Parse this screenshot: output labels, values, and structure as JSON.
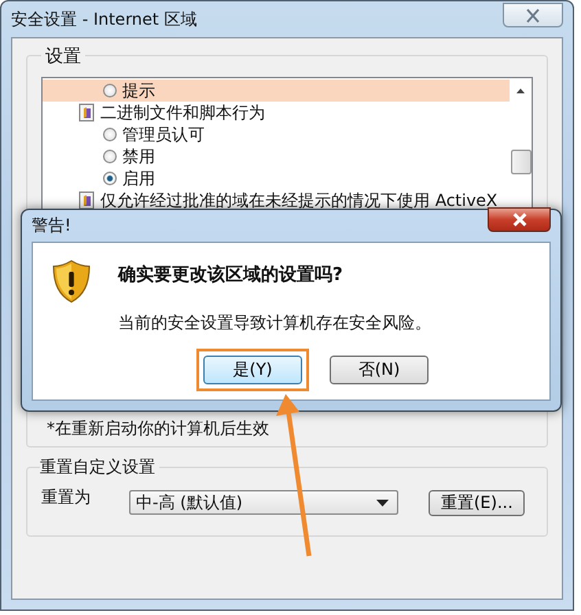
{
  "window": {
    "title": "安全设置 - Internet 区域"
  },
  "settings": {
    "label": "设置",
    "items": [
      {
        "kind": "radio",
        "label": "提示",
        "checked": false,
        "selected": true
      },
      {
        "kind": "category",
        "label": "二进制文件和脚本行为",
        "selected": false
      },
      {
        "kind": "radio",
        "label": "管理员认可",
        "checked": false,
        "selected": false
      },
      {
        "kind": "radio",
        "label": "禁用",
        "checked": false,
        "selected": false
      },
      {
        "kind": "radio",
        "label": "启用",
        "checked": true,
        "selected": false
      },
      {
        "kind": "category",
        "label": "仅允许经过批准的域在未经提示的情况下使用 ActiveX",
        "selected": false
      }
    ]
  },
  "note": "*在重新启动你的计算机后生效",
  "reset": {
    "label": "重置自定义设置",
    "field_label": "重置为",
    "dropdown_value": "中-高 (默认值)",
    "button": "重置(E)..."
  },
  "dialog": {
    "title": "警告!",
    "heading": "确实要更改该区域的设置吗?",
    "message": "当前的安全设置导致计算机存在安全风险。",
    "buttons": [
      {
        "label": "是(Y)",
        "highlighted": true
      },
      {
        "label": "否(N)",
        "highlighted": false
      }
    ]
  }
}
